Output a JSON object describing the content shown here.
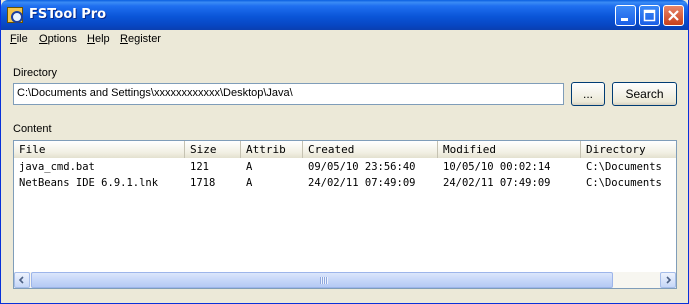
{
  "window": {
    "title": "FSTool Pro",
    "titlebar_color": "#0a55d8"
  },
  "menu": [
    {
      "underline": "F",
      "rest": "ile"
    },
    {
      "underline": "O",
      "rest": "ptions"
    },
    {
      "underline": "H",
      "rest": "elp"
    },
    {
      "underline": "R",
      "rest": "egister"
    }
  ],
  "directory": {
    "label": "Directory",
    "value": "C:\\Documents and Settings\\xxxxxxxxxxxx\\Desktop\\Java\\",
    "browse_label": "...",
    "search_label": "Search"
  },
  "content": {
    "label": "Content",
    "columns": [
      "File",
      "Size",
      "Attrib",
      "Created",
      "Modified",
      "Directory"
    ],
    "rows": [
      [
        "java_cmd.bat",
        "121",
        "A",
        "09/05/10 23:56:40",
        "10/05/10 00:02:14",
        "C:\\Documents"
      ],
      [
        "NetBeans IDE 6.9.1.lnk",
        "1718",
        "A",
        "24/02/11 07:49:09",
        "24/02/11 07:49:09",
        "C:\\Documents"
      ]
    ]
  },
  "icons": {
    "app": "fstool-app-icon",
    "minimize": "minimize-icon",
    "maximize": "maximize-icon",
    "close": "close-icon",
    "scroll_left": "arrow-left-icon",
    "scroll_right": "arrow-right-icon"
  }
}
